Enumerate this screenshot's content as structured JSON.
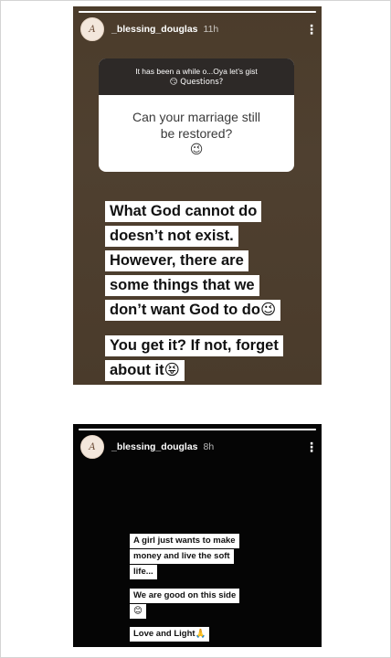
{
  "stories": [
    {
      "username": "_blessing_douglas",
      "time": "11h",
      "avatar_letter": "A",
      "progress": 1.0,
      "question": {
        "prompt_line1": "It has been a while o...Oya let’s gist",
        "prompt_line2": "😏 Questions?",
        "text_line1": "Can your marriage still",
        "text_line2": "be restored?",
        "emoji": "😉"
      },
      "lines": [
        "What God cannot do",
        "doesn’t not exist.",
        "However, there are",
        "some things that we",
        "don’t want God to do😉"
      ],
      "lines2": [
        "You get it? If not, forget",
        "about it😝"
      ]
    },
    {
      "username": "_blessing_douglas",
      "time": "8h",
      "avatar_letter": "A",
      "progress": 1.0,
      "blocks": [
        [
          "A girl just wants to make",
          "money and live the soft",
          "life..."
        ],
        [
          "We are good on this side",
          "😊"
        ],
        [
          "Love and Light🙏"
        ]
      ]
    }
  ],
  "icons": {
    "more": "more-vertical-icon"
  }
}
